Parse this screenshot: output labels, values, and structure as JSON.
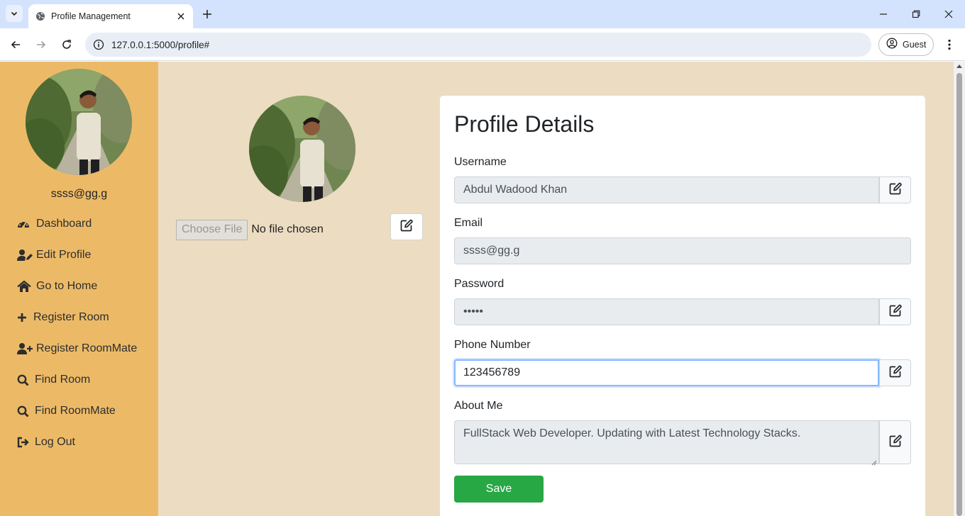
{
  "browser": {
    "tab_title": "Profile Management",
    "url": "127.0.0.1:5000/profile#",
    "profile_label": "Guest",
    "icons": {
      "tab_list": "chevron-down-icon",
      "favicon": "globe-icon",
      "close_tab": "close-icon",
      "new_tab": "plus-icon",
      "minimize": "minimize-icon",
      "maximize": "restore-icon",
      "close_window": "close-icon",
      "back": "arrow-left-icon",
      "forward": "arrow-right-icon",
      "reload": "reload-icon",
      "site_info": "info-icon",
      "profile": "user-circle-icon",
      "menu": "more-vertical-icon"
    }
  },
  "colors": {
    "page_bg": "#ecdcc1",
    "sidebar_bg": "#ecba67",
    "save_button": "#28a745",
    "focus_border": "#86b7fe"
  },
  "sidebar": {
    "email": "ssss@gg.g",
    "avatar": "profile-photo",
    "items": [
      {
        "label": "Dashboard",
        "icon": "dashboard-icon"
      },
      {
        "label": "Edit Profile",
        "icon": "user-edit-icon"
      },
      {
        "label": "Go to Home",
        "icon": "home-icon"
      },
      {
        "label": "Register Room",
        "icon": "plus-icon"
      },
      {
        "label": "Register RoomMate",
        "icon": "user-plus-icon"
      },
      {
        "label": "Find Room",
        "icon": "search-icon"
      },
      {
        "label": "Find RoomMate",
        "icon": "search-icon"
      },
      {
        "label": "Log Out",
        "icon": "logout-icon"
      }
    ]
  },
  "photo_upload": {
    "choose_label": "Choose File",
    "status": "No file chosen",
    "edit_icon": "edit-icon"
  },
  "profile": {
    "title": "Profile Details",
    "fields": {
      "username": {
        "label": "Username",
        "value": "Abdul Wadood Khan"
      },
      "email": {
        "label": "Email",
        "value": "ssss@gg.g"
      },
      "password": {
        "label": "Password",
        "value": "•••••"
      },
      "phone": {
        "label": "Phone Number",
        "value": "123456789"
      },
      "about": {
        "label": "About Me",
        "value": "FullStack Web Developer. Updating with Latest Technology Stacks."
      }
    },
    "save_label": "Save"
  }
}
